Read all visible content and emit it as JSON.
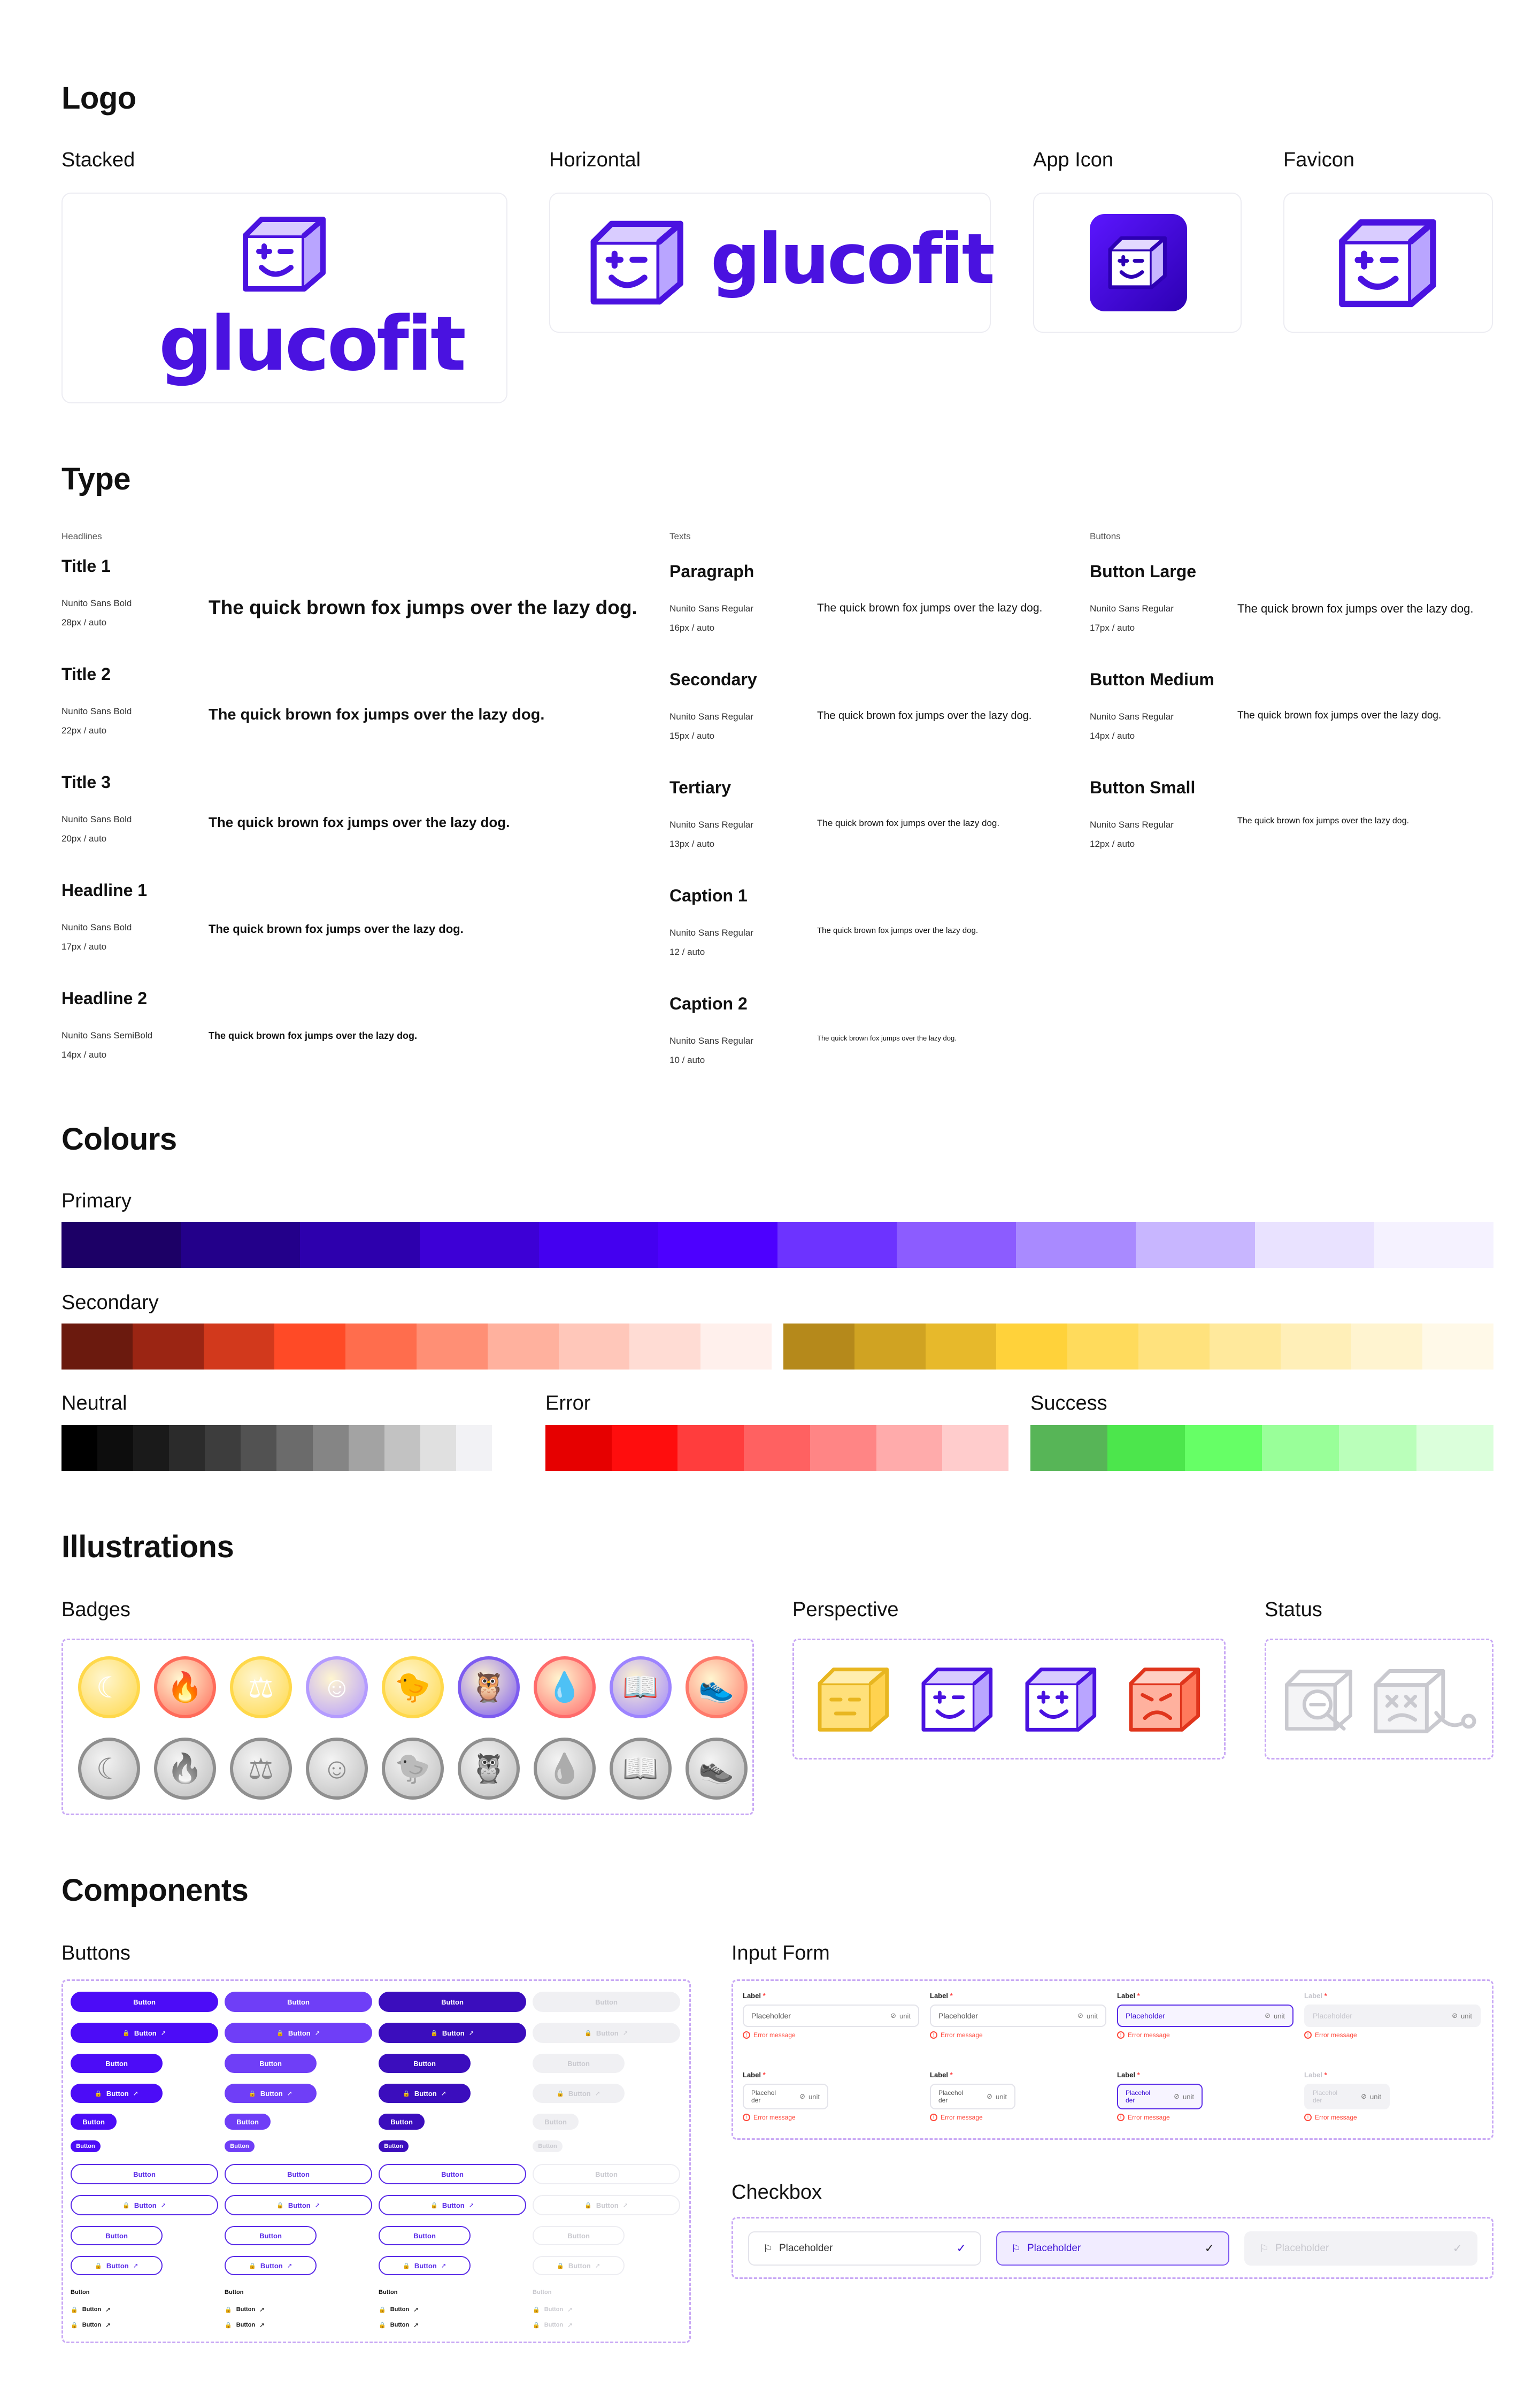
{
  "sections": {
    "logo": "Logo",
    "type": "Type",
    "colours": "Colours",
    "illustrations": "Illustrations",
    "components": "Components"
  },
  "logo": {
    "stacked": "Stacked",
    "horizontal": "Horizontal",
    "app_icon": "App Icon",
    "favicon": "Favicon",
    "wordmark": "glucofit",
    "brand_color": "#4a12e0"
  },
  "type": {
    "columns": {
      "headlines": "Headlines",
      "texts": "Texts",
      "buttons": "Buttons"
    },
    "sample": "The quick brown fox jumps over the lazy dog.",
    "headlines": [
      {
        "name": "Title 1",
        "font": "Nunito Sans Bold",
        "size": "28px / auto"
      },
      {
        "name": "Title 2",
        "font": "Nunito Sans Bold",
        "size": "22px / auto"
      },
      {
        "name": "Title 3",
        "font": "Nunito Sans Bold",
        "size": "20px / auto"
      },
      {
        "name": "Headline 1",
        "font": "Nunito Sans Bold",
        "size": "17px / auto"
      },
      {
        "name": "Headline 2",
        "font": "Nunito Sans SemiBold",
        "size": "14px / auto"
      }
    ],
    "texts": [
      {
        "name": "Paragraph",
        "font": "Nunito Sans Regular",
        "size": "16px / auto"
      },
      {
        "name": "Secondary",
        "font": "Nunito Sans Regular",
        "size": "15px / auto"
      },
      {
        "name": "Tertiary",
        "font": "Nunito Sans Regular",
        "size": "13px / auto"
      },
      {
        "name": "Caption 1",
        "font": "Nunito Sans Regular",
        "size": "12 / auto"
      },
      {
        "name": "Caption 2",
        "font": "Nunito Sans Regular",
        "size": "10 / auto"
      }
    ],
    "buttons": [
      {
        "name": "Button Large",
        "font": "Nunito Sans Regular",
        "size": "17px / auto"
      },
      {
        "name": "Button Medium",
        "font": "Nunito Sans Regular",
        "size": "14px / auto"
      },
      {
        "name": "Button Small",
        "font": "Nunito Sans Regular",
        "size": "12px / auto"
      }
    ]
  },
  "colours": {
    "primary_label": "Primary",
    "secondary_label": "Secondary",
    "neutral_label": "Neutral",
    "error_label": "Error",
    "success_label": "Success",
    "primary": [
      "#1c0066",
      "#23008a",
      "#2d00ad",
      "#3d00d6",
      "#4400f0",
      "#4d00ff",
      "#6d33ff",
      "#8c5cff",
      "#a98aff",
      "#c8b6ff",
      "#e9e2ff",
      "#f5f2ff"
    ],
    "secondary_red": [
      "#6b1a0e",
      "#9b2513",
      "#d2391c",
      "#ff4a26",
      "#ff6d4d",
      "#ff8f75",
      "#ffb19e",
      "#ffc7ba",
      "#ffdcd4",
      "#fff0ec"
    ],
    "secondary_yellow": [
      "#b5891b",
      "#d0a322",
      "#e7b92b",
      "#ffd23a",
      "#ffdb5c",
      "#ffe27d",
      "#ffe99c",
      "#ffefb8",
      "#fff4d0",
      "#fff9e8"
    ],
    "neutral": [
      "#000000",
      "#0d0d0d",
      "#1a1a1a",
      "#2b2b2b",
      "#3d3d3d",
      "#525252",
      "#6b6b6b",
      "#858585",
      "#a3a3a3",
      "#c2c2c2",
      "#e0e0e0",
      "#f2f2f5"
    ],
    "error": [
      "#e60000",
      "#ff0d0d",
      "#ff3d3d",
      "#ff6161",
      "#ff8585",
      "#ffabab",
      "#ffcccc"
    ],
    "success": [
      "#57b557",
      "#4ce64c",
      "#66ff66",
      "#99ff99",
      "#baffba",
      "#dbffdb"
    ]
  },
  "illustrations": {
    "badges": "Badges",
    "perspective": "Perspective",
    "status": "Status",
    "badge_icons_color": [
      "☾",
      "🔥",
      "⚖",
      "☺",
      "🐤",
      "🦉",
      "💧",
      "📖",
      "👟"
    ],
    "badge_icons_gray": [
      "☾",
      "🔥",
      "⚖",
      "☺",
      "🐤",
      "🦉",
      "💧",
      "📖",
      "👟"
    ]
  },
  "components": {
    "buttons": "Buttons",
    "input_form": "Input Form",
    "checkbox": "Checkbox",
    "button_label": "Button",
    "input_label": "Label",
    "placeholder": "Placeholder",
    "placeholder_wrap": "Placehol der",
    "unit": "unit",
    "error_message": "Error message",
    "check_placeholder": "Placeholder"
  }
}
